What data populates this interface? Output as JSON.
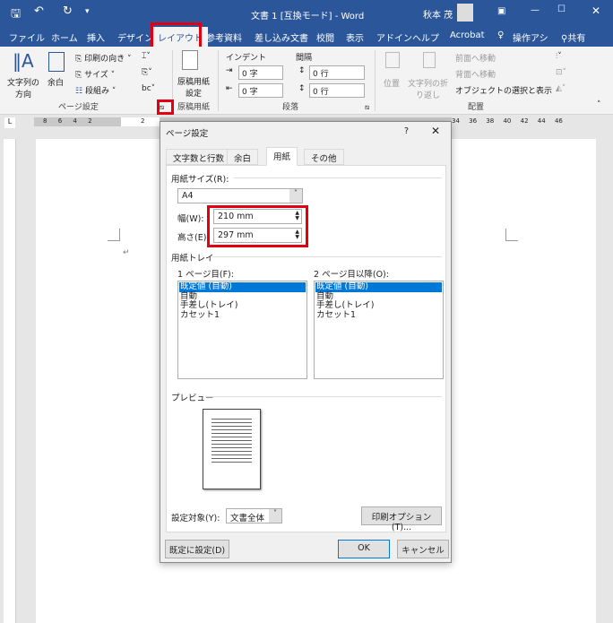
{
  "window": {
    "title": "文書 1 [互換モード] - Word",
    "user": "秋本 茂"
  },
  "qat": {
    "save": "save-icon",
    "undo": "undo-icon",
    "redo": "redo-icon"
  },
  "tabs": [
    "ファイル",
    "ホーム",
    "挿入",
    "デザイン",
    "レイアウト",
    "参考資料",
    "差し込み文書",
    "校閲",
    "表示",
    "アドイン",
    "ヘルプ",
    "Acrobat",
    "操作アシ",
    "共有"
  ],
  "ribbon": {
    "text_direction": "文字列の\n方向",
    "margins": "余白",
    "orientation": "印刷の向き",
    "size": "サイズ",
    "columns": "段組み",
    "page_setup_group": "ページ設定",
    "manuscript": "原稿用紙\n設定",
    "manuscript_group": "原稿用紙",
    "indent": "インデント",
    "spacing": "間隔",
    "indent_left": "0 字",
    "indent_right": "0 字",
    "space_before": "0 行",
    "space_after": "0 行",
    "paragraph_group": "段落",
    "position": "位置",
    "wrap": "文字列の折\nり返し",
    "bring_forward": "前面へ移動",
    "send_backward": "背面へ移動",
    "selection_pane": "オブジェクトの選択と表示",
    "arrange_group": "配置"
  },
  "ruler": {
    "left": [
      "8",
      "6",
      "4",
      "2"
    ],
    "right": [
      "34",
      "36",
      "38",
      "40",
      "42",
      "44",
      "46"
    ],
    "center": "2"
  },
  "dialog": {
    "title": "ページ設定",
    "help": "?",
    "tabs": [
      "文字数と行数",
      "余白",
      "用紙",
      "その他"
    ],
    "active_tab": "用紙",
    "paper_size_label": "用紙サイズ(R):",
    "paper_size": "A4",
    "width_label": "幅(W):",
    "width": "210 mm",
    "height_label": "高さ(E):",
    "height": "297 mm",
    "tray_label": "用紙トレイ",
    "first_page_label": "1 ページ目(F):",
    "other_pages_label": "2 ページ目以降(O):",
    "tray_options": [
      "既定値 (自動)",
      "自動",
      "手差し(トレイ)",
      "カセット1"
    ],
    "preview_label": "プレビュー",
    "apply_to_label": "設定対象(Y):",
    "apply_to": "文書全体",
    "print_options": "印刷オプション(T)...",
    "set_default": "既定に設定(D)",
    "ok": "OK",
    "cancel": "キャンセル"
  },
  "highlight_color": "#e00012",
  "accent": "#2b579a"
}
